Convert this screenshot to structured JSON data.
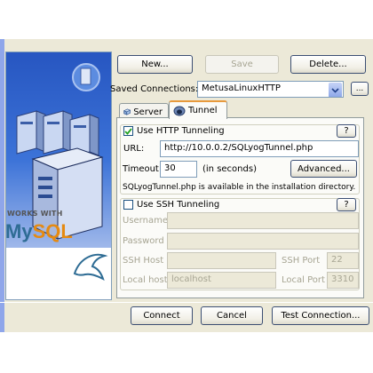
{
  "toolbar": {
    "new_label": "New...",
    "save_label": "Save",
    "delete_label": "Delete..."
  },
  "connections": {
    "label": "Saved Connections:",
    "selected": "MetusaLinuxHTTP",
    "more_label": "..."
  },
  "tabs": [
    {
      "label": "Server",
      "active": false
    },
    {
      "label": "Tunnel",
      "active": true
    }
  ],
  "http": {
    "checkbox_label": "Use HTTP Tunneling",
    "checked": true,
    "help_label": "?",
    "url_label": "URL:",
    "url_value": "http://10.0.0.2/SQLyogTunnel.php",
    "timeout_label": "Timeout:",
    "timeout_value": "30",
    "timeout_unit": "(in seconds)",
    "advanced_label": "Advanced...",
    "info_text": "SQLyogTunnel.php is available in the installation directory."
  },
  "ssh": {
    "checkbox_label": "Use SSH Tunneling",
    "checked": false,
    "help_label": "?",
    "username_label": "Username",
    "password_label": "Password",
    "host_label": "SSH Host",
    "port_label": "SSH Port",
    "port_value": "22",
    "localhost_label": "Local host",
    "localhost_value": "localhost",
    "localport_label": "Local Port",
    "localport_value": "3310"
  },
  "footer": {
    "connect_label": "Connect",
    "cancel_label": "Cancel",
    "test_label": "Test Connection..."
  },
  "banner": {
    "works_with": "WORKS WITH",
    "brand_my": "My",
    "brand_sql": "SQL"
  },
  "colors": {
    "dialog_bg": "#ece9d8",
    "banner_blue": "#2b5ec7",
    "tab_accent": "#e89a3c",
    "mysql_blue": "#2e6c94",
    "mysql_orange": "#e58a12"
  }
}
